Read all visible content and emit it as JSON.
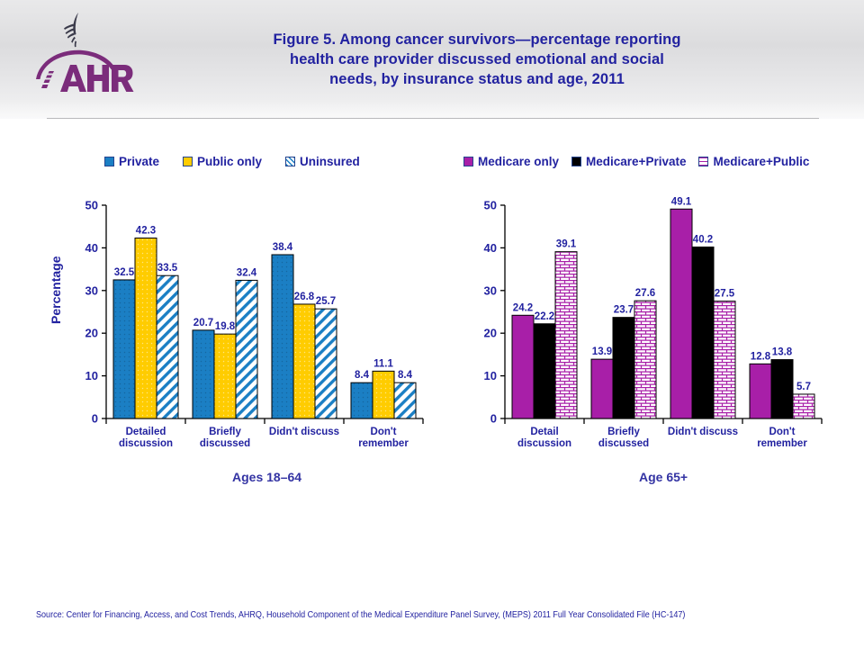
{
  "header": {
    "title": "Figure 5. Among cancer survivors—percentage reporting health care provider discussed emotional and social needs, by insurance status and age, 2011",
    "title_lines": [
      "Figure 5. Among cancer survivors—percentage reporting",
      "health care provider discussed emotional and social",
      "needs, by insurance status and age, 2011"
    ],
    "logo_text": "AHRQ",
    "agency_mark": "hhs-eagle-icon"
  },
  "source": {
    "text": "Source: Center for Financing, Access, and Cost Trends, AHRQ, Household Component of the Medical Expenditure Panel Survey, (MEPS) 2011 Full Year Consolidated File (HC-147)"
  },
  "colors": {
    "title_blue": "#2222a0",
    "private_blue": "#1B7FC4",
    "public_gold": "#FFCC00",
    "uninsured_hatch": "#1B7FC4",
    "medicare_purple": "#A81FA8",
    "medicare_private_black": "#000000",
    "medicare_public_brick": "#A81FA8",
    "axis_black": "#000000"
  },
  "chart_data": [
    {
      "type": "bar",
      "title": "Ages 18–64",
      "xlabel": "",
      "ylabel": "Percentage",
      "ylim": [
        0,
        50
      ],
      "yticks": [
        0,
        10,
        20,
        30,
        40,
        50
      ],
      "grid": false,
      "legend_position": "top",
      "categories": [
        "Detailed discussion",
        "Briefly discussed",
        "Didn't discuss",
        "Don't remember"
      ],
      "category_lines": [
        [
          "Detailed",
          "discussion"
        ],
        [
          "Briefly",
          "discussed"
        ],
        [
          "Didn't discuss"
        ],
        [
          "Don't",
          "remember"
        ]
      ],
      "series": [
        {
          "name": "Private",
          "values": [
            32.5,
            20.7,
            38.4,
            8.4
          ],
          "fill": "#1B7FC4",
          "pattern": "dots"
        },
        {
          "name": "Public only",
          "values": [
            42.3,
            19.8,
            26.8,
            11.1
          ],
          "fill": "#FFCC00",
          "pattern": "dots"
        },
        {
          "name": "Uninsured",
          "values": [
            33.5,
            32.4,
            25.7,
            8.4
          ],
          "fill": "#FFFFFF",
          "pattern": "diagonal-stripes"
        }
      ]
    },
    {
      "type": "bar",
      "title": "Age 65+",
      "xlabel": "",
      "ylabel": "",
      "ylim": [
        0,
        50
      ],
      "yticks": [
        0,
        10,
        20,
        30,
        40,
        50
      ],
      "grid": false,
      "legend_position": "top",
      "categories": [
        "Detail discussion",
        "Briefly discussed",
        "Didn't discuss",
        "Don't remember"
      ],
      "category_lines": [
        [
          "Detail",
          "discussion"
        ],
        [
          "Briefly",
          "discussed"
        ],
        [
          "Didn't discuss"
        ],
        [
          "Don't",
          "remember"
        ]
      ],
      "series": [
        {
          "name": "Medicare only",
          "values": [
            24.2,
            13.9,
            49.1,
            12.8
          ],
          "fill": "#A81FA8",
          "pattern": "solid"
        },
        {
          "name": "Medicare+Private",
          "values": [
            22.2,
            23.7,
            40.2,
            13.8
          ],
          "fill": "#000000",
          "pattern": "solid"
        },
        {
          "name": "Medicare+Public",
          "values": [
            39.1,
            27.6,
            27.5,
            5.7
          ],
          "fill": "#FFFFFF",
          "pattern": "brick"
        }
      ]
    }
  ]
}
